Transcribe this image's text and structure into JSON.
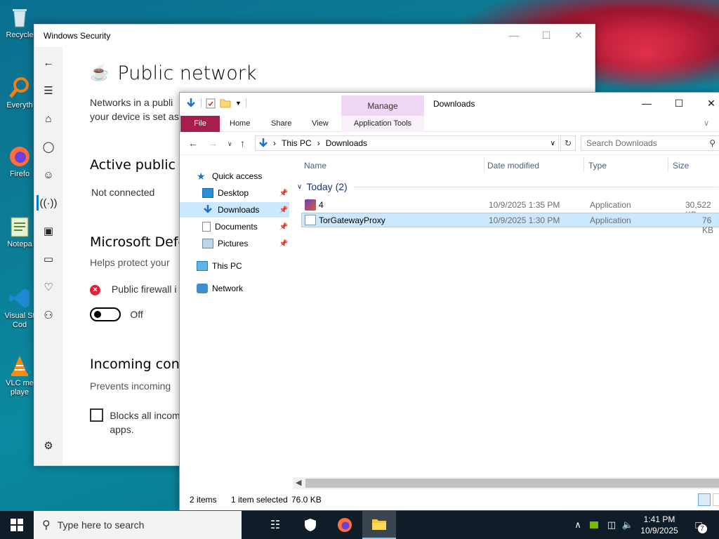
{
  "desktop": {
    "icons": [
      {
        "label": "Recycle",
        "icon": "recycle-bin-icon"
      },
      {
        "label": "Everyth",
        "icon": "everything-search-icon"
      },
      {
        "label": "Firefo",
        "icon": "firefox-icon"
      },
      {
        "label": "Notepa",
        "icon": "notepad-icon"
      },
      {
        "label": "Visual St Cod",
        "icon": "vscode-icon"
      },
      {
        "label": "VLC me playe",
        "icon": "vlc-icon"
      }
    ]
  },
  "security": {
    "window_title": "Windows Security",
    "page_title": "Public network",
    "intro_line1": "Networks in a publi",
    "intro_line2": "your device is set as",
    "active_heading": "Active public n",
    "active_value": "Not connected",
    "defender_heading": "Microsoft Defe",
    "defender_sub": "Helps protect your",
    "firewall_status": "Public firewall i",
    "toggle_label": "Off",
    "incoming_heading": "Incoming conn",
    "incoming_sub": "Prevents incoming",
    "block_line1": "Blocks all incom",
    "block_line2": "apps."
  },
  "explorer": {
    "window_title": "Downloads",
    "context_tab": "Manage",
    "ribbon_tabs": {
      "file": "File",
      "home": "Home",
      "share": "Share",
      "view": "View",
      "app_tools": "Application Tools"
    },
    "address": {
      "seg1": "This PC",
      "seg2": "Downloads"
    },
    "search_placeholder": "Search Downloads",
    "nav": {
      "quick_access": "Quick access",
      "desktop": "Desktop",
      "downloads": "Downloads",
      "documents": "Documents",
      "pictures": "Pictures",
      "this_pc": "This PC",
      "network": "Network"
    },
    "columns": {
      "name": "Name",
      "date": "Date modified",
      "type": "Type",
      "size": "Size"
    },
    "group": "Today (2)",
    "files": [
      {
        "name": "4",
        "date": "10/9/2025 1:35 PM",
        "type": "Application",
        "size": "30,522 KB"
      },
      {
        "name": "TorGatewayProxy",
        "date": "10/9/2025 1:30 PM",
        "type": "Application",
        "size": "76 KB"
      }
    ],
    "status": {
      "count": "2 items",
      "selected": "1 item selected",
      "size": "76.0 KB"
    }
  },
  "taskbar": {
    "search_placeholder": "Type here to search",
    "time": "1:41 PM",
    "date": "10/9/2025",
    "notifications": "7"
  }
}
